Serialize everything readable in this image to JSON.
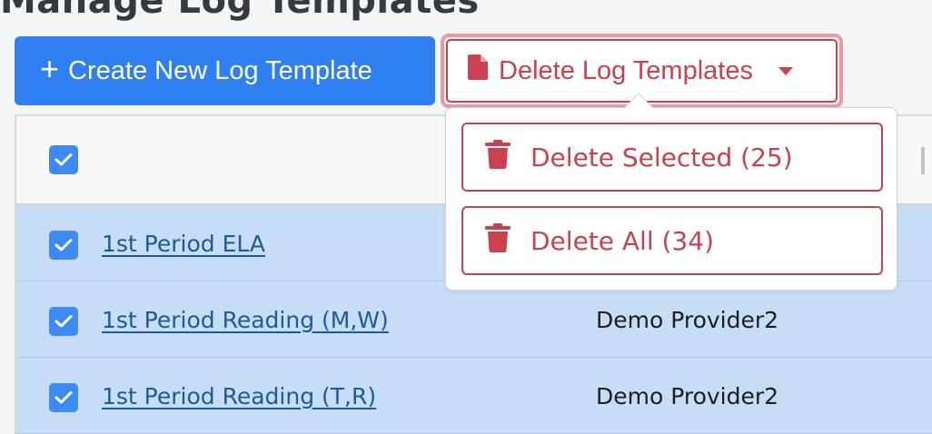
{
  "page": {
    "heading": "Manage Log Templates"
  },
  "toolbar": {
    "create_label": "Create New Log Template",
    "delete_label": "Delete Log Templates"
  },
  "dropdown": {
    "items": [
      {
        "label": "Delete Selected (25)",
        "icon": "trash-icon"
      },
      {
        "label": "Delete All (34)",
        "icon": "trash-icon"
      }
    ]
  },
  "table": {
    "select_all_checked": true,
    "rows": [
      {
        "name": "1st Period ELA",
        "provider": "",
        "checked": true
      },
      {
        "name": "1st Period Reading (M,W)",
        "provider": "Demo Provider2",
        "checked": true
      },
      {
        "name": "1st Period Reading (T,R)",
        "provider": "Demo Provider2",
        "checked": true
      }
    ]
  },
  "colors": {
    "primary": "#2f7ff0",
    "danger": "#c9414f",
    "selected_row": "#c7ddf6",
    "checkbox": "#3d8bf2",
    "link": "#1b5a9b"
  }
}
